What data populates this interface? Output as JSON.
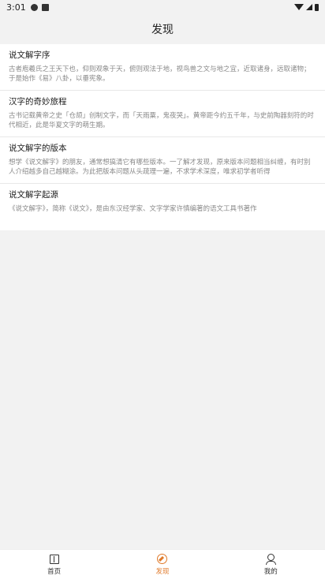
{
  "status_bar": {
    "time": "3:01",
    "icons": [
      "alert-icon",
      "a-icon",
      "wifi-icon",
      "signal-icon",
      "battery-icon"
    ]
  },
  "header": {
    "title": "发现"
  },
  "articles": [
    {
      "title": "说文解字序",
      "desc": "古者庖羲氏之王天下也，仰则观象于天，俯则观法于地，视鸟兽之文与地之宜，近取诸身，远取诸物；于是始作《易》八卦，以垂宪象。"
    },
    {
      "title": "汉字的奇妙旅程",
      "desc": "古书记载黄帝之史「仓颉」创制文字，而「天雨粟，鬼夜哭」。黄帝距今约五千年，与史前陶器刻符的时代相近，此是华夏文字的萌生期。"
    },
    {
      "title": "说文解字的版本",
      "desc": "想学《说文解字》的朋友，通常想搞清它有哪些版本。一了解才发现，原来版本问题相当纠缠，有时别人介绍越多自己越糊涂。为此把版本问题从头疏理一遍，不求学术深度，唯求初学者听得"
    },
    {
      "title": "说文解字起源",
      "desc": "《说文解字》，简称《说文》，是由东汉经学家、文字学家许慎编著的语文工具书著作"
    }
  ],
  "tabbar": {
    "tabs": [
      {
        "label": "首页",
        "icon": "book-icon",
        "active": false
      },
      {
        "label": "发现",
        "icon": "compass-icon",
        "active": true
      },
      {
        "label": "我的",
        "icon": "person-icon",
        "active": false
      }
    ],
    "active_color": "#e07a2a"
  }
}
